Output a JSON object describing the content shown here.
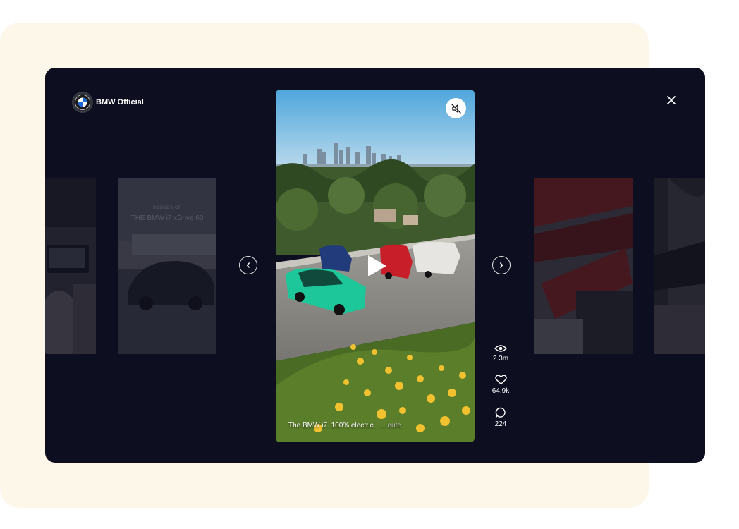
{
  "profile": {
    "name": "BMW Official",
    "avatar_icon": "bmw-logo-icon"
  },
  "side_videos": {
    "left_card": {
      "caption_small": "SOUNDS OF",
      "caption_large": "THE BMW i7 xDrive 60"
    }
  },
  "main_video": {
    "caption": "The BMW i7. 100% electric.",
    "more_label": "... eute",
    "mute_icon": "muted-speaker-icon",
    "play_icon": "play-icon"
  },
  "stats": {
    "views": "2.3m",
    "likes": "64.9k",
    "comments": "224"
  },
  "colors": {
    "overlay_bg": "#0d0e1f",
    "cream_bg": "#fdf7ea",
    "text": "#ffffff"
  }
}
